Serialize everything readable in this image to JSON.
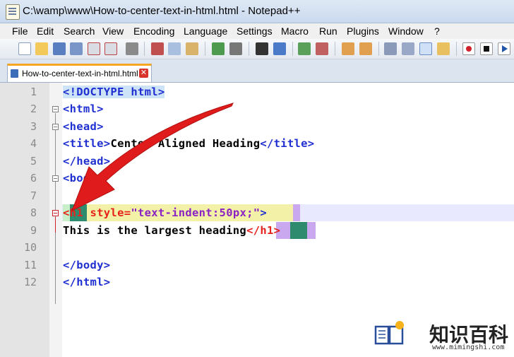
{
  "window": {
    "title": "C:\\wamp\\www\\How-to-center-text-in-html.html - Notepad++"
  },
  "menu": [
    "File",
    "Edit",
    "Search",
    "View",
    "Encoding",
    "Language",
    "Settings",
    "Macro",
    "Run",
    "Plugins",
    "Window",
    "?"
  ],
  "tab": {
    "label": "How-to-center-text-in-html.html",
    "close": "✕"
  },
  "lines": [
    "1",
    "2",
    "3",
    "4",
    "5",
    "6",
    "7",
    "8",
    "9",
    "10",
    "11",
    "12"
  ],
  "code": {
    "l1": "<!DOCTYPE html>",
    "l2": "<html>",
    "l3": "<head>",
    "l4_open": "<title>",
    "l4_text": "Center Aligned Heading",
    "l4_close": "</title>",
    "l5": "</head>",
    "l6": "<body>",
    "l8_open": "<h1",
    "l8_attr": " style=",
    "l8_val": "\"text-indent:50px;\"",
    "l8_close": ">",
    "l9_text": "This is the largest heading",
    "l9_close": "</h1>",
    "l11": "</body>",
    "l12": "</html>"
  },
  "watermark": {
    "brand": "知识百科",
    "url": "www.mimingshi.com"
  },
  "colors": {
    "tag": "#1f2fd1",
    "attr": "#e6231d",
    "value": "#8a22c4",
    "arrow": "#e01b1b",
    "tab_accent": "#f5a623"
  },
  "icons": [
    "app-icon",
    "new-file-icon",
    "open-file-icon",
    "save-icon",
    "save-all-icon",
    "close-icon",
    "close-all-icon",
    "print-icon",
    "cut-icon",
    "copy-icon",
    "paste-icon",
    "undo-icon",
    "redo-icon",
    "find-icon",
    "replace-icon",
    "zoom-in-icon",
    "zoom-out-icon",
    "sync-v-icon",
    "sync-h-icon",
    "wrap-icon",
    "show-all-chars-icon",
    "indent-guide-icon",
    "doc-map-icon",
    "record-macro-icon",
    "stop-macro-icon",
    "play-macro-icon",
    "arrow-annotation-icon",
    "book-lightbulb-icon"
  ]
}
